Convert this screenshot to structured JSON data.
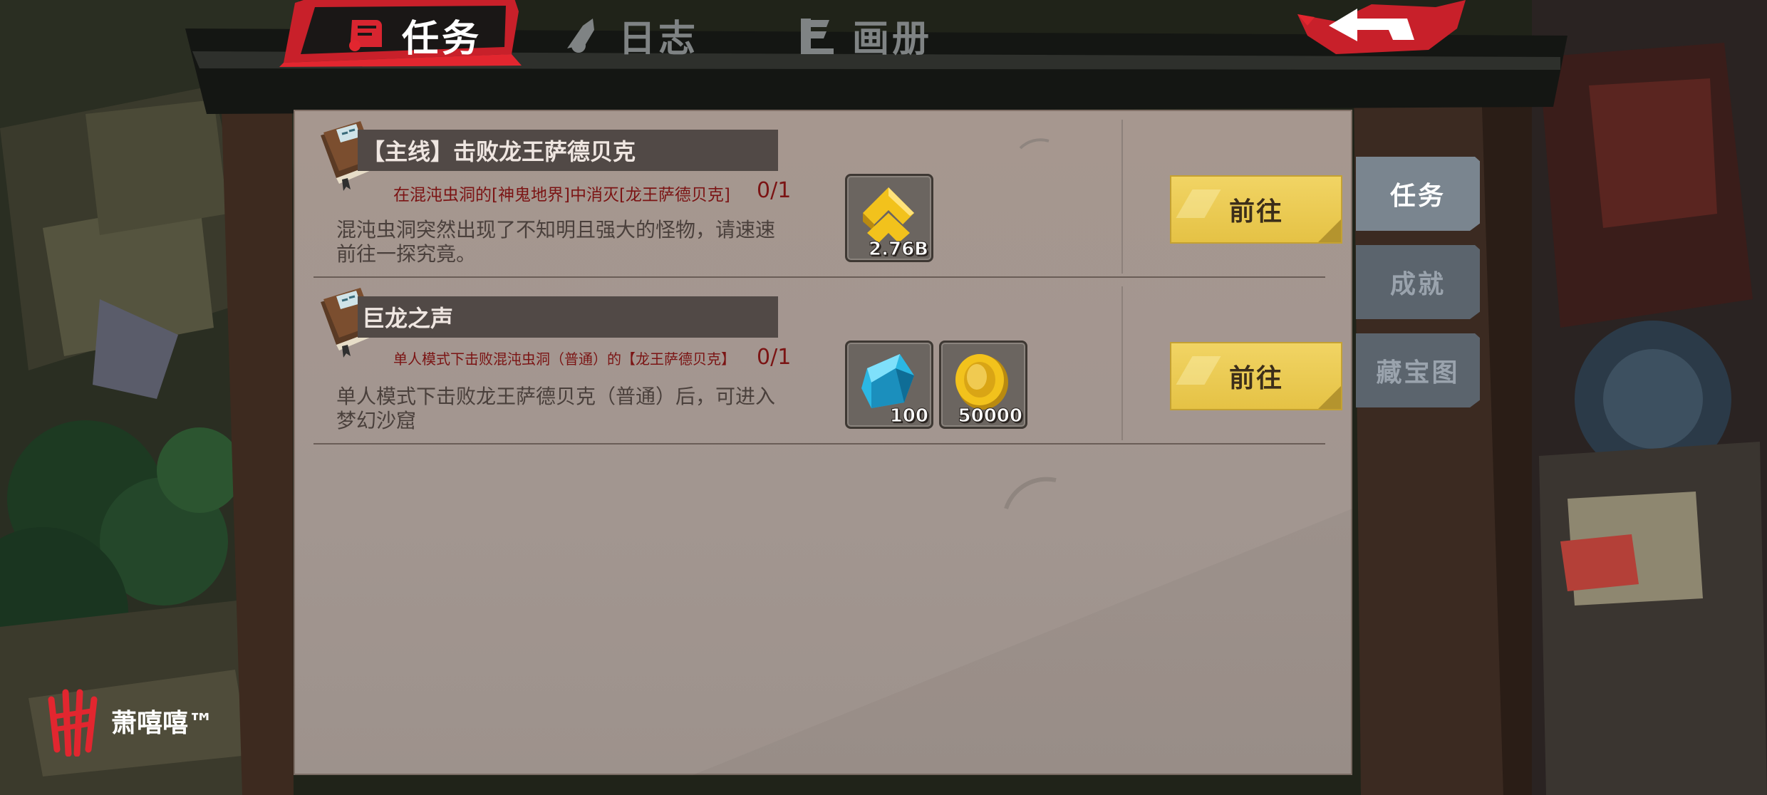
{
  "top_tabs": [
    {
      "label": "任务",
      "icon": "scroll-icon",
      "active": true
    },
    {
      "label": "日志",
      "icon": "quill-icon",
      "active": false
    },
    {
      "label": "画册",
      "icon": "album-icon",
      "active": false
    }
  ],
  "back_button": {
    "icon": "back-arrow-icon"
  },
  "quests": [
    {
      "title": "【主线】击败龙王萨德贝克",
      "objective": "在混沌虫洞的[神鬼地界]中消灭[龙王萨德贝克]",
      "progress": "0/1",
      "description": "混沌虫洞突然出现了不知明且强大的怪物，请速速前往一探究竟。",
      "rewards": [
        {
          "icon": "gold-bars-icon",
          "count": "2.76B"
        }
      ],
      "go_label": "前往"
    },
    {
      "title": "巨龙之声",
      "objective": "单人模式下击败混沌虫洞（普通）的【龙王萨德贝克】",
      "progress": "0/1",
      "description": "单人模式下击败龙王萨德贝克（普通）后，可进入梦幻沙窟",
      "rewards": [
        {
          "icon": "blue-crystal-icon",
          "count": "100"
        },
        {
          "icon": "gold-coin-icon",
          "count": "50000"
        }
      ],
      "go_label": "前往"
    }
  ],
  "side_tabs": [
    {
      "label": "任务",
      "active": true
    },
    {
      "label": "成就",
      "active": false
    },
    {
      "label": "藏宝图",
      "active": false
    }
  ],
  "watermark": {
    "text": "萧嘻嘻™"
  },
  "colors": {
    "panel": "#a39690",
    "title_bar": "#514946",
    "objective_red": "#7b1414",
    "go_button": "#ebc94f",
    "side_tab": "#5b646d",
    "accent_red": "#e2262f"
  }
}
